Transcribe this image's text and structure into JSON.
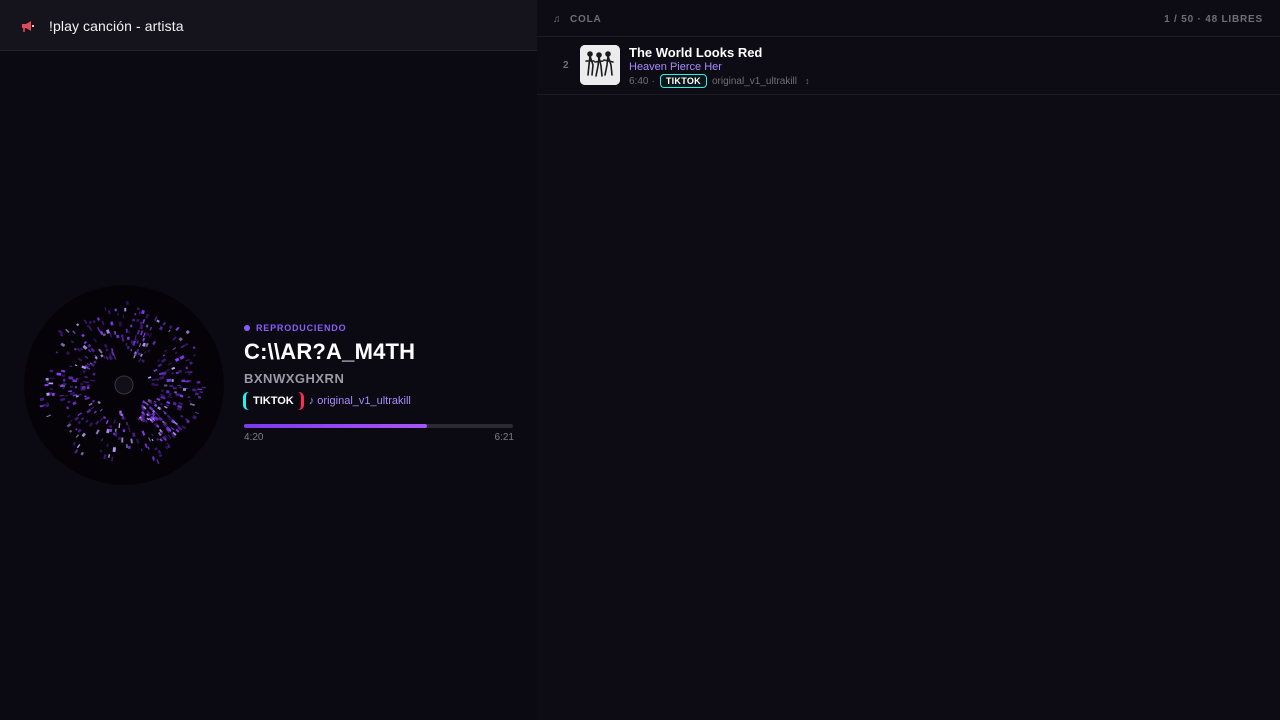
{
  "request_bar": {
    "icon": "megaphone-icon",
    "text": "!play canción - artista"
  },
  "now_playing": {
    "status": "REPRODUCIENDO",
    "title": "C:\\\\AR?A_M4TH",
    "artist": "BXNWXGHXRN",
    "source_badge": "TIKTOK",
    "sound": "♪ original_v1_ultrakill",
    "progress_fraction": 0.68,
    "time_current": "4:20",
    "time_total": "6:21"
  },
  "queue": {
    "label": "COLA",
    "count": "1 / 50 · 48 LIBRES",
    "items": [
      {
        "index": "2",
        "title": "The World Looks Red",
        "artist": "Heaven Pierce Her",
        "duration": "6:40",
        "separator": "·",
        "source_badge": "TIKTOK",
        "sound": "original_v1_ultrakill",
        "extra": "↕"
      }
    ]
  },
  "colors": {
    "accent": "#8b5cf6",
    "accent_light": "#a78bfa",
    "tiktok_cyan": "#25f4ee",
    "tiktok_red": "#fe2c55",
    "background": "#0b0a13"
  }
}
